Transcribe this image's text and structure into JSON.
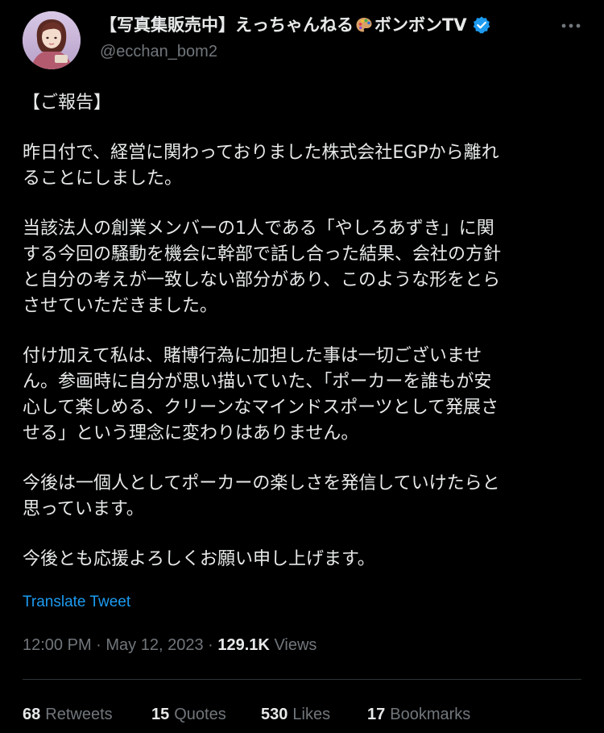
{
  "author": {
    "display_name_prefix": "【写真集販売中】えっちゃんねる",
    "display_name_suffix": "ボンボンTV",
    "handle": "@ecchan_bom2",
    "palette_icon": "artist-palette-emoji",
    "verified_icon": "verified-badge-icon",
    "verified_color": "#1d9bf0"
  },
  "more_icon": "more-horizontal-icon",
  "tweet": {
    "lines": [
      "【ご報告】",
      "",
      "昨日付で、経営に関わっておりました株式会社EGPから離れ",
      "ることにしました。",
      "",
      "当該法人の創業メンバーの1人である「やしろあずき」に関",
      "する今回の騒動を機会に幹部で話し合った結果、会社の方針",
      "と自分の考えが一致しない部分があり、このような形をとら",
      "させていただきました。",
      "",
      "付け加えて私は、賭博行為に加担した事は一切ございませ",
      "ん。参画時に自分が思い描いていた、「ポーカーを誰もが安",
      "心して楽しめる、クリーンなマインドスポーツとして発展さ",
      "せる」という理念に変わりはありません。",
      "",
      "今後は一個人としてポーカーの楽しさを発信していけたらと",
      "思っています。",
      "",
      "今後とも応援よろしくお願い申し上げます。"
    ]
  },
  "translate_label": "Translate Tweet",
  "meta": {
    "time": "12:00 PM",
    "separator": "·",
    "date": "May 12, 2023",
    "views_count": "129.1K",
    "views_label": "Views"
  },
  "stats": [
    {
      "count": "68",
      "label": "Retweets"
    },
    {
      "count": "15",
      "label": "Quotes"
    },
    {
      "count": "530",
      "label": "Likes"
    },
    {
      "count": "17",
      "label": "Bookmarks"
    }
  ],
  "colors": {
    "background": "#000000",
    "text": "#e7e9ea",
    "secondary": "#71767b",
    "link": "#1d9bf0",
    "divider": "#2f3336"
  }
}
